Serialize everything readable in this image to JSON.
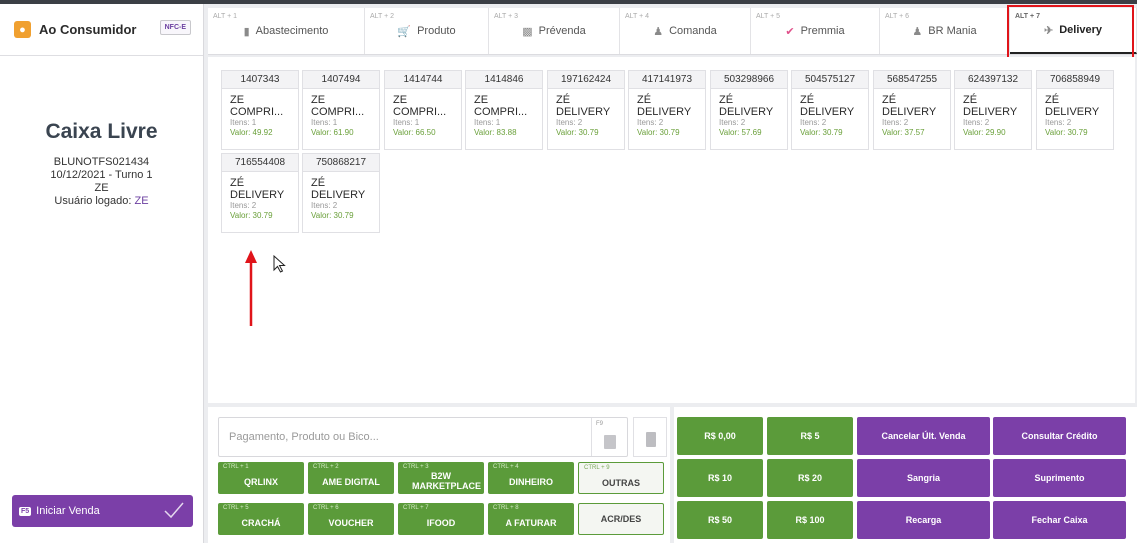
{
  "left": {
    "customer_label": "Ao Consumidor",
    "nfce_label": "NFC-E",
    "status_title": "Caixa Livre",
    "terminal": "BLUNOTFS021434",
    "date_shift": "10/12/2021 - Turno 1",
    "operator": "ZE",
    "logged_user_label": "Usuário logado: ",
    "logged_user": "ZE",
    "start_key": "F5",
    "start_label": "Iniciar Venda"
  },
  "tabs": [
    {
      "shortcut": "ALT + 1",
      "label": "Abastecimento",
      "icon": "fuel-pump-icon"
    },
    {
      "shortcut": "ALT + 2",
      "label": "Produto",
      "icon": "cart-icon"
    },
    {
      "shortcut": "ALT + 3",
      "label": "Prévenda",
      "icon": "ticket-icon"
    },
    {
      "shortcut": "ALT + 4",
      "label": "Comanda",
      "icon": "person-icon"
    },
    {
      "shortcut": "ALT + 5",
      "label": "Premmia",
      "icon": "check-circle-icon"
    },
    {
      "shortcut": "ALT + 6",
      "label": "BR Mania",
      "icon": "person-icon"
    },
    {
      "shortcut": "ALT + 7",
      "label": "Delivery",
      "icon": "delivery-icon",
      "active": true
    }
  ],
  "orders": [
    {
      "number": "1407343",
      "name1": "ZE",
      "name2": "COMPRI...",
      "items": "Itens: 1",
      "value": "Valor: 49.92"
    },
    {
      "number": "1407494",
      "name1": "ZE",
      "name2": "COMPRI...",
      "items": "Itens: 1",
      "value": "Valor: 61.90"
    },
    {
      "number": "1414744",
      "name1": "ZE",
      "name2": "COMPRI...",
      "items": "Itens: 1",
      "value": "Valor: 66.50"
    },
    {
      "number": "1414846",
      "name1": "ZE",
      "name2": "COMPRI...",
      "items": "Itens: 1",
      "value": "Valor: 83.88"
    },
    {
      "number": "197162424",
      "name1": "ZÉ",
      "name2": "DELIVERY",
      "items": "Itens: 2",
      "value": "Valor: 30.79"
    },
    {
      "number": "417141973",
      "name1": "ZÉ",
      "name2": "DELIVERY",
      "items": "Itens: 2",
      "value": "Valor: 30.79"
    },
    {
      "number": "503298966",
      "name1": "ZÉ",
      "name2": "DELIVERY",
      "items": "Itens: 2",
      "value": "Valor: 57.69"
    },
    {
      "number": "504575127",
      "name1": "ZÉ",
      "name2": "DELIVERY",
      "items": "Itens: 2",
      "value": "Valor: 30.79"
    },
    {
      "number": "568547255",
      "name1": "ZÉ",
      "name2": "DELIVERY",
      "items": "Itens: 2",
      "value": "Valor: 37.57"
    },
    {
      "number": "624397132",
      "name1": "ZÉ",
      "name2": "DELIVERY",
      "items": "Itens: 2",
      "value": "Valor: 29.90"
    },
    {
      "number": "706858949",
      "name1": "ZÉ",
      "name2": "DELIVERY",
      "items": "Itens: 2",
      "value": "Valor: 30.79"
    },
    {
      "number": "716554408",
      "name1": "ZÉ",
      "name2": "DELIVERY",
      "items": "Itens: 2",
      "value": "Valor: 30.79"
    },
    {
      "number": "750868217",
      "name1": "ZÉ",
      "name2": "DELIVERY",
      "items": "Itens: 2",
      "value": "Valor: 30.79"
    }
  ],
  "payment": {
    "search_placeholder": "Pagamento, Produto ou Bico...",
    "f9_key": "F9",
    "buttons": [
      {
        "shortcut": "CTRL + 1",
        "label": "QRLINX"
      },
      {
        "shortcut": "CTRL + 2",
        "label": "AME DIGITAL"
      },
      {
        "shortcut": "CTRL + 3",
        "label": "B2W MARKETPLACE"
      },
      {
        "shortcut": "CTRL + 4",
        "label": "DINHEIRO"
      },
      {
        "shortcut": "CTRL + 9",
        "label": "OUTRAS"
      },
      {
        "shortcut": "CTRL + 5",
        "label": "CRACHÁ"
      },
      {
        "shortcut": "CTRL + 6",
        "label": "VOUCHER"
      },
      {
        "shortcut": "CTRL + 7",
        "label": "IFOOD"
      },
      {
        "shortcut": "CTRL + 8",
        "label": "A FATURAR"
      },
      {
        "shortcut": "",
        "label": "ACR/DES"
      }
    ]
  },
  "quick": {
    "amounts": [
      "R$ 0,00",
      "R$ 5",
      "R$ 10",
      "R$ 20",
      "R$ 50",
      "R$ 100"
    ],
    "actions": [
      "Cancelar Últ. Venda",
      "Consultar Crédito",
      "Sangria",
      "Suprimento",
      "Recarga",
      "Fechar Caixa"
    ]
  },
  "colors": {
    "accent_purple": "#7b3fa8",
    "accent_green": "#5b9b3a",
    "highlight_red": "#e0141a",
    "value_green": "#6aa03a"
  }
}
